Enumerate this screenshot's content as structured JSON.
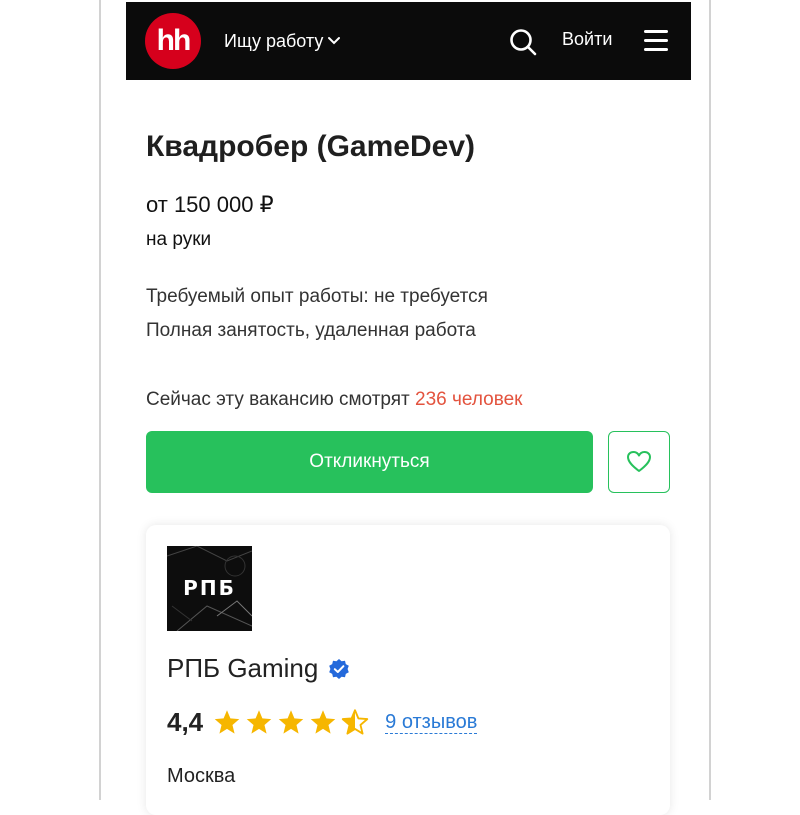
{
  "header": {
    "logo_text": "hh",
    "role_selector": "Ищу работу",
    "login_label": "Войти",
    "icons": {
      "search": "search-icon",
      "menu": "hamburger-menu-icon",
      "chevron": "chevron-down-icon"
    },
    "background": "#0b0b0b",
    "logo_color": "#d6001c"
  },
  "vacancy": {
    "title": "Квадробер (GameDev)",
    "salary": "от 150 000 ₽",
    "salary_note": "на руки",
    "experience": "Требуемый опыт работы: не требуется",
    "employment": "Полная занятость, удаленная работа",
    "viewers_prefix": "Сейчас эту вакансию смотрят ",
    "viewers_count": "236 человек"
  },
  "actions": {
    "apply_label": "Откликнуться",
    "favorite_icon": "heart-icon",
    "accent_color": "#27c15c"
  },
  "company": {
    "logo_text": "РПБ",
    "name": "РПБ Gaming",
    "verified_icon": "verified-badge-icon",
    "rating": "4,4",
    "stars": 4.5,
    "star_color": "#f6b600",
    "reviews_label": "9 отзывов",
    "city": "Москва"
  }
}
